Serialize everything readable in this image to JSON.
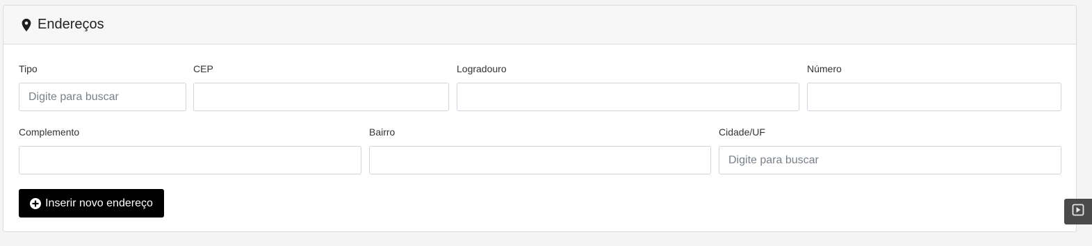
{
  "section": {
    "title": "Endereços",
    "icon": "map-marker-icon"
  },
  "fields": {
    "tipo": {
      "label": "Tipo",
      "placeholder": "Digite para buscar",
      "value": ""
    },
    "cep": {
      "label": "CEP",
      "placeholder": "",
      "value": ""
    },
    "logradouro": {
      "label": "Logradouro",
      "placeholder": "",
      "value": ""
    },
    "numero": {
      "label": "Número",
      "placeholder": "",
      "value": ""
    },
    "complemento": {
      "label": "Complemento",
      "placeholder": "",
      "value": ""
    },
    "bairro": {
      "label": "Bairro",
      "placeholder": "",
      "value": ""
    },
    "cidade_uf": {
      "label": "Cidade/UF",
      "placeholder": "Digite para buscar",
      "value": ""
    }
  },
  "actions": {
    "add_address_label": "Inserir novo endereço",
    "add_address_icon": "plus-circle-icon"
  },
  "side_toggle": {
    "icon": "play-square-icon"
  },
  "colors": {
    "button_bg": "#000000",
    "header_bg": "#f7f7f7",
    "toggle_bg": "#4a4a4a"
  }
}
